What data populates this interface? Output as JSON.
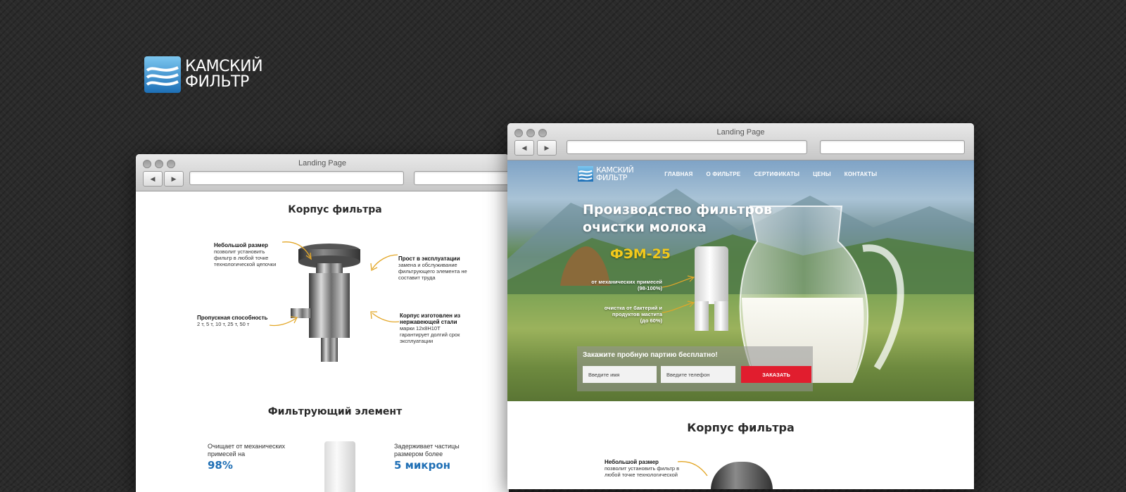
{
  "brand": {
    "line1": "КАМСКИЙ",
    "line2": "ФИЛЬТР"
  },
  "colors": {
    "accent": "#1f6fb5",
    "order_button": "#e11d2e",
    "product_name": "#f2c91b"
  },
  "back_window": {
    "title": "Landing Page",
    "section1_title": "Корпус фильтра",
    "annotations": [
      {
        "title": "Небольшой размер",
        "text": "позволит установить фильтр в любой точке технологической цепочки"
      },
      {
        "title": "Прост в эксплуатации",
        "text": "замена и обслуживание фильтрующего элемента не составит труда"
      },
      {
        "title": "Пропускная способность",
        "text": "2 т, 5 т, 10 т, 25 т, 50 т"
      },
      {
        "title": "Корпус изготовлен из нержавеющей стали",
        "text": "марки 12х8Н10Т гарантирует долгий срок эксплуатации"
      }
    ],
    "section2_title": "Фильтрующий элемент",
    "stat1": {
      "label": "Очищает от механических примесей на",
      "value": "98%"
    },
    "stat2": {
      "label": "Задерживает частицы размером более",
      "value": "5 микрон"
    }
  },
  "front_window": {
    "title": "Landing Page",
    "nav": [
      "ГЛАВНАЯ",
      "О ФИЛЬТРЕ",
      "СЕРТИФИКАТЫ",
      "ЦЕНЫ",
      "КОНТАКТЫ"
    ],
    "hero_title": "Производство фильтров очистки молока",
    "product": "ФЭМ-25",
    "feature1": {
      "line1": "от механических примесей",
      "line2": "(98-100%)"
    },
    "feature2": {
      "line1": "очистка от бактерий и",
      "line2": "продуктов мастита",
      "line3": "(до 60%)"
    },
    "order": {
      "title": "Закажите пробную партию бесплатно!",
      "name_placeholder": "Введите имя",
      "phone_placeholder": "Введите телефон",
      "button": "ЗАКАЗАТЬ"
    },
    "section_title": "Корпус фильтра",
    "annotation": {
      "title": "Небольшой размер",
      "text": "позволит установить фильтр в любой точке технологической"
    }
  }
}
